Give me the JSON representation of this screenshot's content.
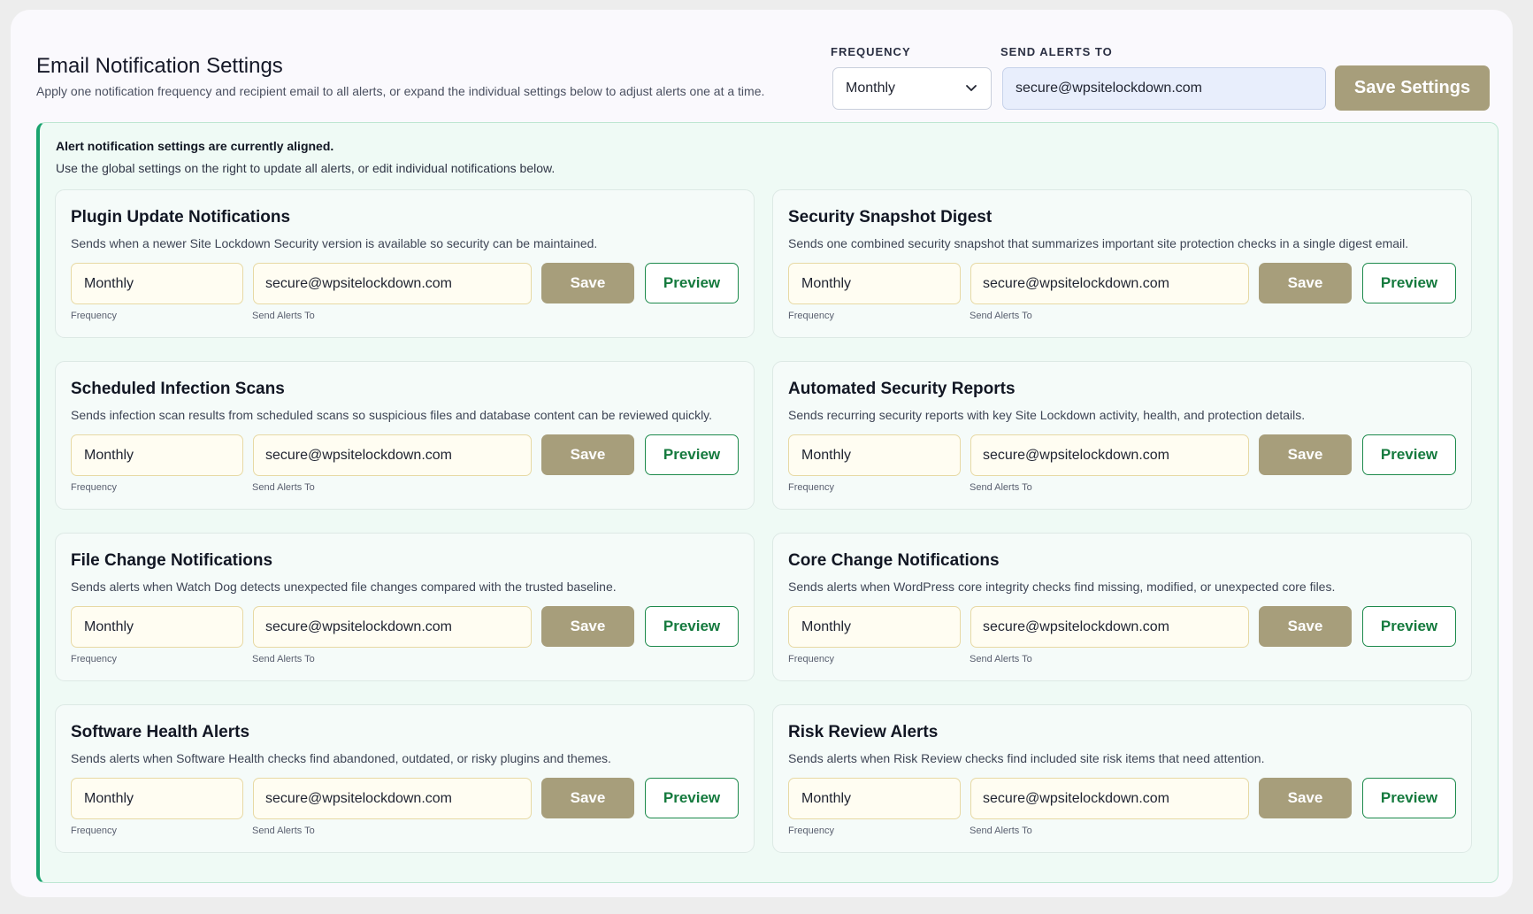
{
  "header": {
    "title": "Email Notification Settings",
    "subtitle": "Apply one notification frequency and recipient email to all alerts, or expand the individual settings below to adjust alerts one at a time."
  },
  "global": {
    "frequency_label": "FREQUENCY",
    "frequency_value": "Monthly",
    "email_label": "SEND ALERTS TO",
    "email_value": "secure@wpsitelockdown.com",
    "save_label": "Save Settings"
  },
  "panel": {
    "status": "Alert notification settings are currently aligned.",
    "hint": "Use the global settings on the right to update all alerts, or edit individual notifications below."
  },
  "cards": [
    {
      "title": "Plugin Update Notifications",
      "description": "Sends when a newer Site Lockdown Security version is available so security can be maintained.",
      "frequency": "Monthly",
      "email": "secure@wpsitelockdown.com",
      "save_label": "Save",
      "preview_label": "Preview",
      "frequency_label": "Frequency",
      "email_label": "Send Alerts To"
    },
    {
      "title": "Security Snapshot Digest",
      "description": "Sends one combined security snapshot that summarizes important site protection checks in a single digest email.",
      "frequency": "Monthly",
      "email": "secure@wpsitelockdown.com",
      "save_label": "Save",
      "preview_label": "Preview",
      "frequency_label": "Frequency",
      "email_label": "Send Alerts To"
    },
    {
      "title": "Scheduled Infection Scans",
      "description": "Sends infection scan results from scheduled scans so suspicious files and database content can be reviewed quickly.",
      "frequency": "Monthly",
      "email": "secure@wpsitelockdown.com",
      "save_label": "Save",
      "preview_label": "Preview",
      "frequency_label": "Frequency",
      "email_label": "Send Alerts To"
    },
    {
      "title": "Automated Security Reports",
      "description": "Sends recurring security reports with key Site Lockdown activity, health, and protection details.",
      "frequency": "Monthly",
      "email": "secure@wpsitelockdown.com",
      "save_label": "Save",
      "preview_label": "Preview",
      "frequency_label": "Frequency",
      "email_label": "Send Alerts To"
    },
    {
      "title": "File Change Notifications",
      "description": "Sends alerts when Watch Dog detects unexpected file changes compared with the trusted baseline.",
      "frequency": "Monthly",
      "email": "secure@wpsitelockdown.com",
      "save_label": "Save",
      "preview_label": "Preview",
      "frequency_label": "Frequency",
      "email_label": "Send Alerts To"
    },
    {
      "title": "Core Change Notifications",
      "description": "Sends alerts when WordPress core integrity checks find missing, modified, or unexpected core files.",
      "frequency": "Monthly",
      "email": "secure@wpsitelockdown.com",
      "save_label": "Save",
      "preview_label": "Preview",
      "frequency_label": "Frequency",
      "email_label": "Send Alerts To"
    },
    {
      "title": "Software Health Alerts",
      "description": "Sends alerts when Software Health checks find abandoned, outdated, or risky plugins and themes.",
      "frequency": "Monthly",
      "email": "secure@wpsitelockdown.com",
      "save_label": "Save",
      "preview_label": "Preview",
      "frequency_label": "Frequency",
      "email_label": "Send Alerts To"
    },
    {
      "title": "Risk Review Alerts",
      "description": "Sends alerts when Risk Review checks find included site risk items that need attention.",
      "frequency": "Monthly",
      "email": "secure@wpsitelockdown.com",
      "save_label": "Save",
      "preview_label": "Preview",
      "frequency_label": "Frequency",
      "email_label": "Send Alerts To"
    }
  ],
  "colors": {
    "accent_save": "#a79e7b",
    "preview_green": "#157a3e",
    "panel_border": "#1aa46f"
  },
  "icons": {
    "select_chevron": "chevron-down-icon"
  }
}
